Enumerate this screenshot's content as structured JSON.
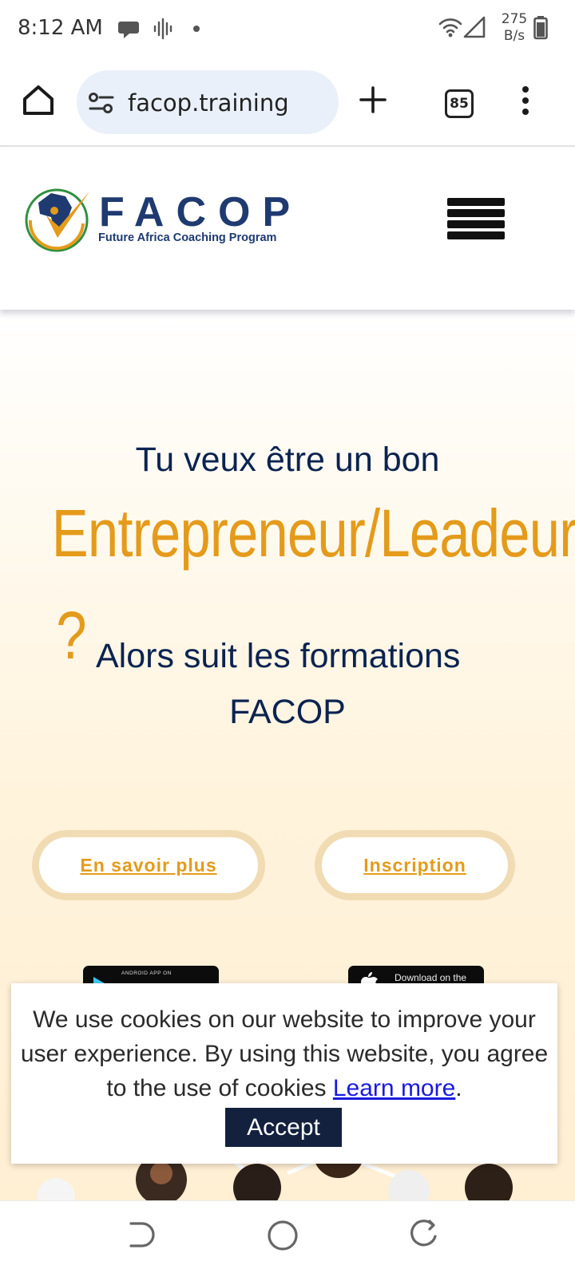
{
  "status_bar": {
    "time": "8:12 AM",
    "net_speed_value": "275",
    "net_speed_unit": "B/s",
    "icons": [
      "chat-bubble-icon",
      "voice-wave-icon",
      "dot-icon",
      "wifi-icon",
      "signal-icon",
      "battery-icon"
    ]
  },
  "browser": {
    "url": "facop.training",
    "tab_count": "85",
    "icons": [
      "home-icon",
      "site-settings-icon",
      "new-tab-plus-icon",
      "tab-switcher-icon",
      "more-menu-icon"
    ]
  },
  "site": {
    "logo_word": "FACOP",
    "logo_tagline": "Future Africa Coaching Program"
  },
  "hero": {
    "line1": "Tu veux être un bon",
    "highlight": "Entrepreneur/Leadeur",
    "question_mark": "?",
    "line3": "Alors suit les formations",
    "line4": "FACOP",
    "cta_primary": "En savoir plus",
    "cta_secondary": "Inscription",
    "store_badge_android_caption": "ANDROID APP ON",
    "store_badge_apple_caption": "Download on the"
  },
  "cookie_banner": {
    "text": "We use cookies on our website to improve your user experience. By using this website, you agree to the use of cookies",
    "link_text": "Learn more",
    "link_suffix": ".",
    "accept_label": "Accept"
  },
  "colors": {
    "brand_navy": "#0b2350",
    "brand_orange": "#e49b1b",
    "button_ring": "#f1dbb2",
    "accept_bg": "#13213f",
    "link_blue": "#1a1ae0"
  },
  "navigation_bar": {
    "icons": [
      "back-gesture-icon",
      "home-circle-icon",
      "recents-icon"
    ]
  }
}
